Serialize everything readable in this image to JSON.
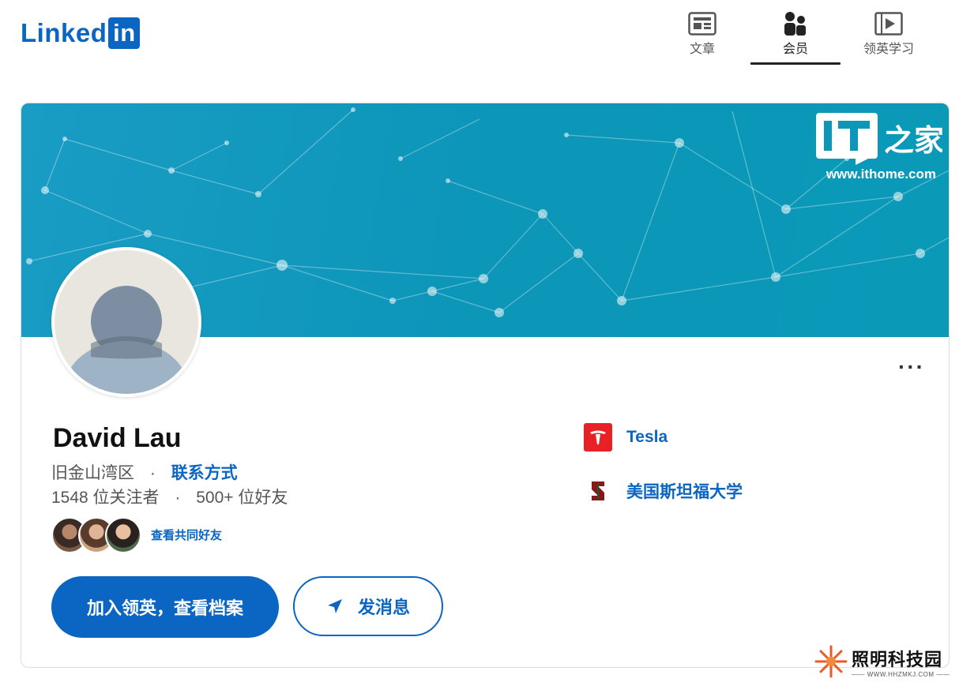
{
  "header": {
    "logo_text": "Linked",
    "logo_in": "in",
    "nav": [
      {
        "label": "文章",
        "icon": "article-icon",
        "active": false
      },
      {
        "label": "会员",
        "icon": "people-icon",
        "active": true
      },
      {
        "label": "领英学习",
        "icon": "learning-icon",
        "active": false
      }
    ]
  },
  "banner": {
    "watermark_logo": "IT之家",
    "watermark_url": "www.ithome.com"
  },
  "profile": {
    "name": "David Lau",
    "location": "旧金山湾区",
    "contact_link": "联系方式",
    "followers": "1548 位关注者",
    "connections": "500+ 位好友",
    "mutual_link": "查看共同好友",
    "more_label": "···"
  },
  "actions": {
    "join_label": "加入领英，查看档案",
    "message_label": "发消息"
  },
  "affiliations": [
    {
      "name": "Tesla",
      "icon": "tesla-logo-icon",
      "color": "#e82127"
    },
    {
      "name": "美国斯坦福大学",
      "icon": "stanford-logo-icon",
      "color": "#8c1515"
    }
  ],
  "footer_watermark": {
    "text": "照明科技园",
    "sub": "—— WWW.HHZMKJ.COM ——"
  },
  "colors": {
    "brand": "#0a66c2",
    "banner": "#1a9cc4"
  }
}
